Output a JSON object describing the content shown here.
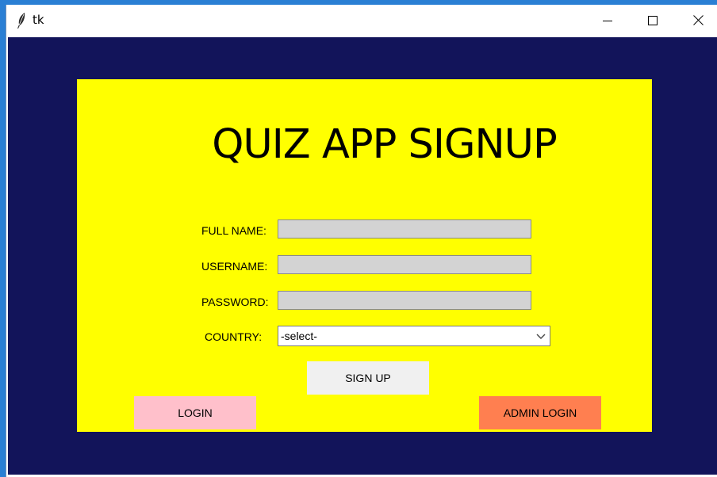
{
  "window": {
    "title": "tk"
  },
  "form": {
    "heading": "QUIZ APP SIGNUP",
    "full_name": {
      "label": "FULL NAME:",
      "value": ""
    },
    "username": {
      "label": "USERNAME:",
      "value": ""
    },
    "password": {
      "label": "PASSWORD:",
      "value": ""
    },
    "country": {
      "label": "COUNTRY:",
      "selected": "-select-"
    },
    "signup_label": "SIGN UP",
    "login_label": "LOGIN",
    "admin_login_label": "ADMIN LOGIN"
  },
  "colors": {
    "background": "#12145a",
    "panel": "#ffff00",
    "login_button": "#ffc0cb",
    "admin_button": "#ff7f50",
    "signup_button": "#f0f0f0",
    "entry": "#d3d3d3"
  }
}
